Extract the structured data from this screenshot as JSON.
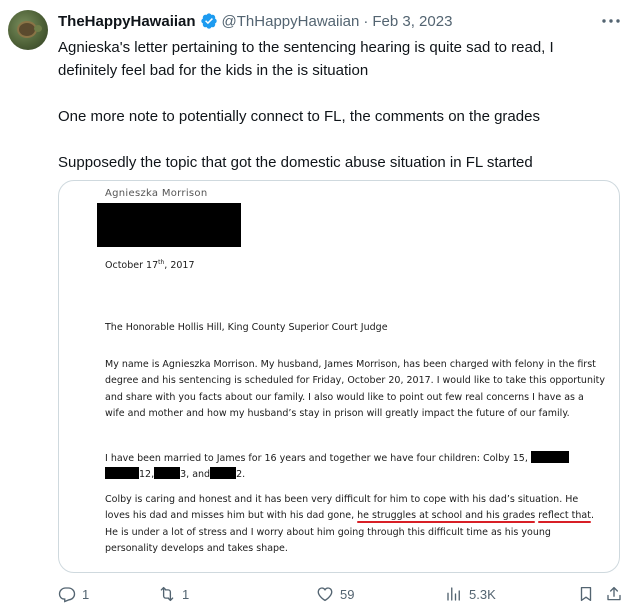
{
  "tweet": {
    "display_name": "TheHappyHawaiian",
    "handle": "@ThHappyHawaiian",
    "separator": "·",
    "date": "Feb 3, 2023",
    "paragraphs": [
      "Agnieska's letter pertaining to the sentencing hearing is quite sad to read, I definitely feel bad for the kids in the is situation",
      "One more note to potentially connect to FL, the comments on the grades",
      "Supposedly the topic that got the domestic abuse situation in FL started"
    ]
  },
  "letter": {
    "author": "Agnieszka Morrison",
    "date_prefix": "October 17",
    "date_suffix": "th",
    "date_year": ", 2017",
    "salutation": "The Honorable Hollis Hill, King County Superior Court Judge",
    "para1": "My name is Agnieszka Morrison. My husband, James Morrison, has been charged with felony in the first degree and his sentencing is scheduled for Friday, October 20, 2017. I would like to take this opportunity and share with you facts about our family. I also would like to point out few real concerns I have as a wife and mother and how my husband’s stay in prison will greatly impact the future of our family.",
    "para2_a": "I have been married to James for 16 years and together we have four children: Colby 15,",
    "para2_b": "12,",
    "para2_c": "3, and",
    "para2_d": "2.",
    "para3_a": "Colby is caring and honest and it has been very difficult for him to cope with his dad’s situation. He loves his dad and misses him but with his dad gone, ",
    "para3_ul1": "he struggles at school and his grades",
    "para3_ul2": "reflect that",
    "para3_b": ". He is under a lot of stress and I worry about him going through this difficult time as his young personality develops and takes shape."
  },
  "actions": {
    "replies": "1",
    "retweets": "1",
    "likes": "59",
    "views": "5.3K"
  },
  "colors": {
    "text": "#0f1419",
    "secondary": "#536471",
    "verified": "#1d9bf0",
    "underline": "#d81f26",
    "border": "#cfd9de"
  },
  "icons": [
    "avatar-turtle",
    "verified-badge-icon",
    "more-icon",
    "reply-icon",
    "retweet-icon",
    "like-icon",
    "views-icon",
    "bookmark-icon",
    "share-icon"
  ]
}
